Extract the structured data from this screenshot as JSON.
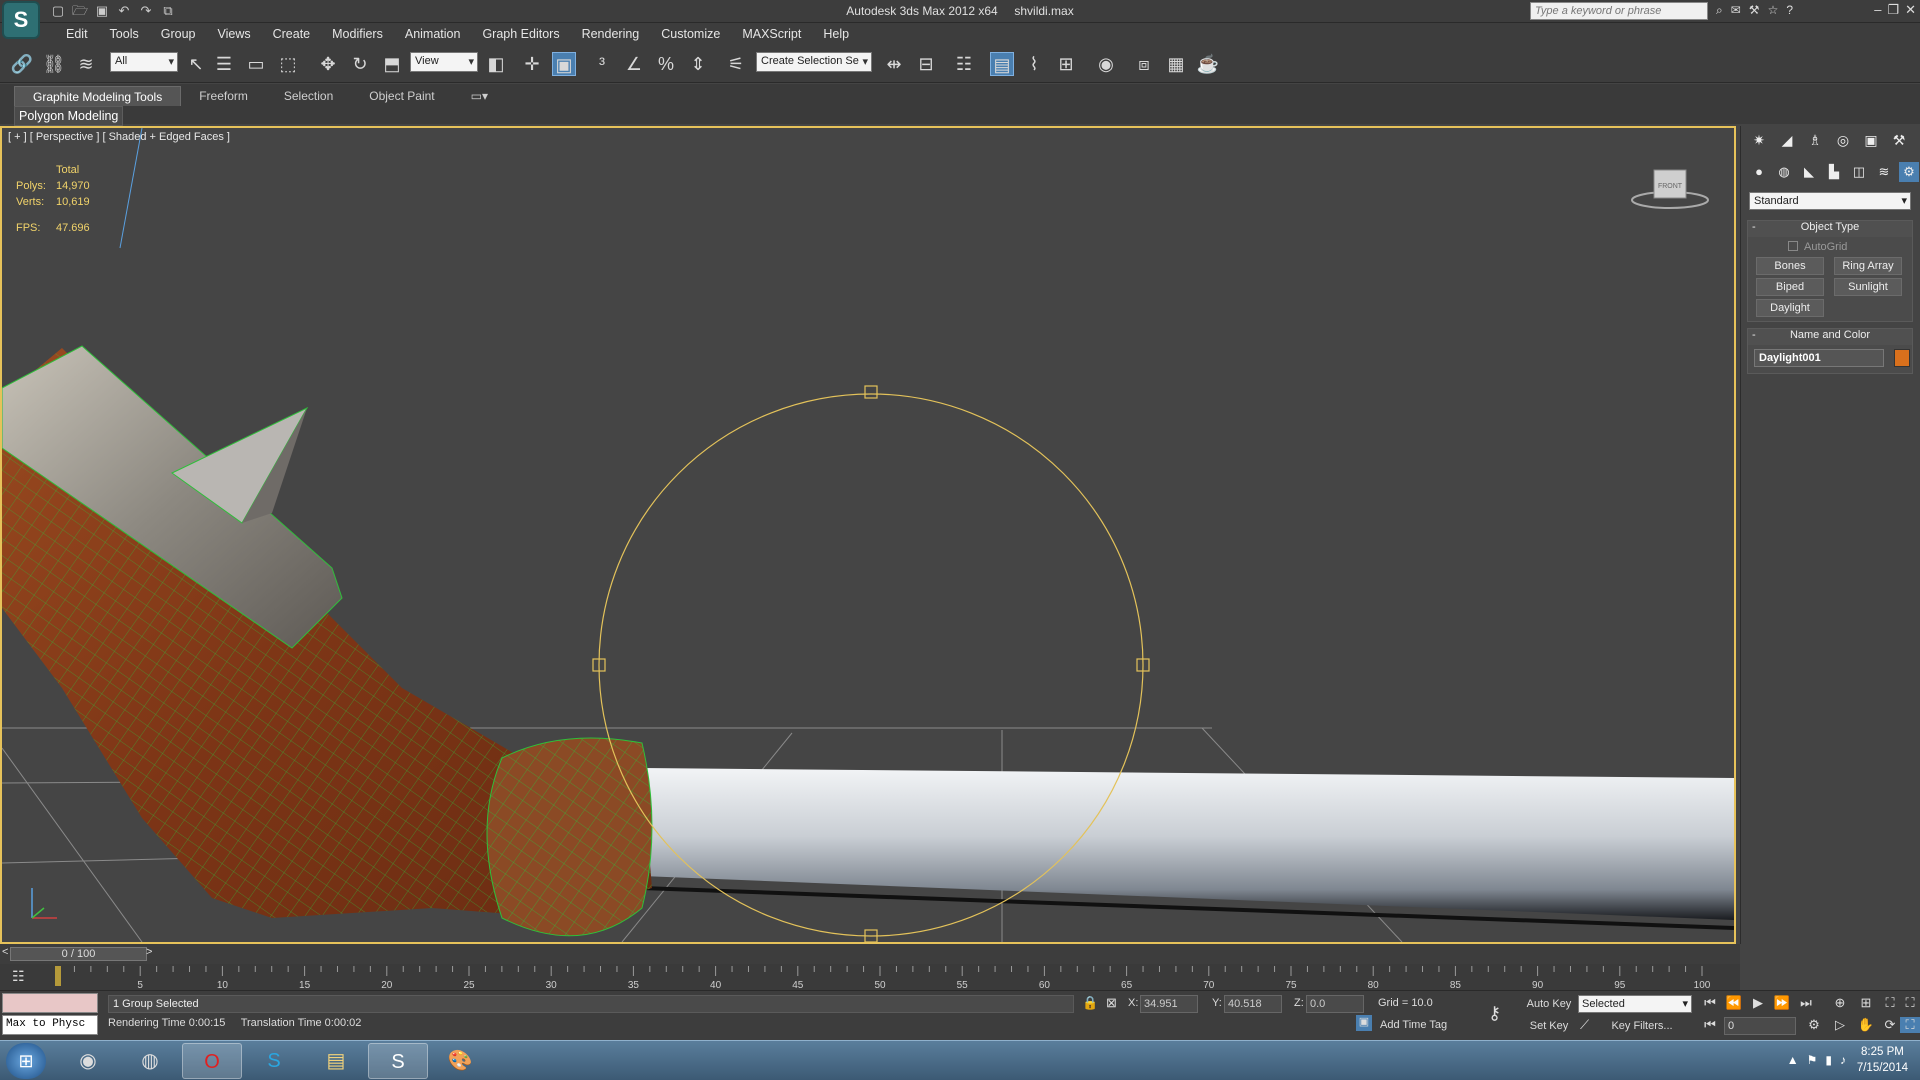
{
  "title": {
    "app": "Autodesk 3ds Max  2012 x64",
    "file": "shvildi.max",
    "search_placeholder": "Type a keyword or phrase"
  },
  "menu": [
    "Edit",
    "Tools",
    "Group",
    "Views",
    "Create",
    "Modifiers",
    "Animation",
    "Graph Editors",
    "Rendering",
    "Customize",
    "MAXScript",
    "Help"
  ],
  "toolbar": {
    "selection_filter": "All",
    "ref_coord": "View",
    "named_selection": "Create Selection Se"
  },
  "ribbon": {
    "tabs": [
      "Graphite Modeling Tools",
      "Freeform",
      "Selection",
      "Object Paint"
    ],
    "panel": "Polygon Modeling"
  },
  "viewport": {
    "label": "[ + ] [ Perspective ] [ Shaded + Edged Faces ]",
    "stats": {
      "total_label": "Total",
      "polys_label": "Polys:",
      "polys": "14,970",
      "verts_label": "Verts:",
      "verts": "10,619",
      "fps_label": "FPS:",
      "fps": "47.696"
    },
    "viewcube_label": "FRONT"
  },
  "command_panel": {
    "category": "Standard",
    "object_type_title": "Object Type",
    "autogrid": "AutoGrid",
    "buttons": [
      "Bones",
      "Ring Array",
      "Biped",
      "Sunlight",
      "Daylight"
    ],
    "name_color_title": "Name and Color",
    "object_name": "Daylight001",
    "object_color": "#d9701c"
  },
  "timeline": {
    "slider": "0 / 100",
    "prev": "<",
    "next": ">",
    "ticks": [
      "5",
      "10",
      "15",
      "20",
      "25",
      "30",
      "35",
      "40",
      "45",
      "50",
      "55",
      "60",
      "65",
      "70",
      "75",
      "80",
      "85",
      "90",
      "95",
      "100"
    ]
  },
  "status": {
    "maxscript": "Max to Physc",
    "selection": "1 Group Selected",
    "rendering_time": "Rendering Time  0:00:15",
    "translation_time": "Translation Time  0:00:02",
    "x_label": "X:",
    "x": "34.951",
    "y_label": "Y:",
    "y": "40.518",
    "z_label": "Z:",
    "z": "0.0",
    "grid": "Grid = 10.0",
    "add_time_tag": "Add Time Tag",
    "auto_key": "Auto Key",
    "set_key": "Set Key",
    "key_mode": "Selected",
    "key_filters": "Key Filters...",
    "frame": "0"
  },
  "taskbar": {
    "time": "8:25 PM",
    "date": "7/15/2014"
  }
}
